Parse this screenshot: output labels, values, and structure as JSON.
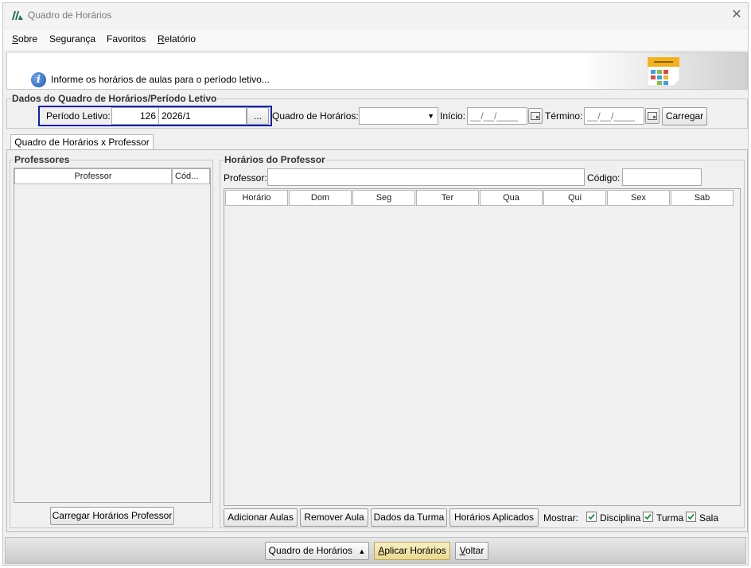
{
  "window": {
    "title": "Quadro de Horários"
  },
  "menu": [
    {
      "label": "Sobre",
      "accel_index": 0
    },
    {
      "label": "Segurança",
      "accel_index": -1
    },
    {
      "label": "Favoritos",
      "accel_index": -1
    },
    {
      "label": "Relatório",
      "accel_index": 0
    }
  ],
  "info": {
    "message": "Informe os horários de aulas para o período letivo..."
  },
  "dados": {
    "group_title": "Dados do Quadro de Horários/Período Letivo",
    "periodo_label": "Período Letivo:",
    "periodo_code": "126",
    "periodo_value": "2026/1",
    "browse_label": "...",
    "quadro_label": "Quadro de Horários:",
    "quadro_value": "",
    "inicio_label": "Início:",
    "inicio_value": "__/__/____",
    "termino_label": "Término:",
    "termino_value": "__/__/____",
    "carregar_label": "Carregar"
  },
  "tabs": [
    {
      "label": "Quadro de Horários x Professor",
      "active": true
    }
  ],
  "professores": {
    "group_title": "Professores",
    "columns": [
      "Professor",
      "Cód..."
    ],
    "rows": [],
    "load_button": "Carregar Horários Professor"
  },
  "horarios": {
    "group_title": "Horários do Professor",
    "professor_label": "Professor:",
    "professor_value": "",
    "codigo_label": "Código:",
    "codigo_value": "",
    "columns": [
      "Horário",
      "Dom",
      "Seg",
      "Ter",
      "Qua",
      "Qui",
      "Sex",
      "Sab"
    ],
    "rows": []
  },
  "actions": {
    "adicionar": "Adicionar Aulas",
    "remover": "Remover Aula",
    "dados_turma": "Dados da Turma",
    "aplicados": "Horários Aplicados",
    "mostrar_label": "Mostrar:",
    "checks": [
      {
        "label": "Disciplina",
        "checked": true
      },
      {
        "label": "Turma",
        "checked": true
      },
      {
        "label": "Sala",
        "checked": true
      }
    ]
  },
  "footer": {
    "quadro_button": "Quadro de Horários",
    "aplicar_button": "Aplicar Horários",
    "voltar_button": "Voltar"
  },
  "colors": {
    "accent": "#0a1fb8",
    "highlight_btn": "#f3e6a8",
    "check_green": "#1f8f3a"
  }
}
